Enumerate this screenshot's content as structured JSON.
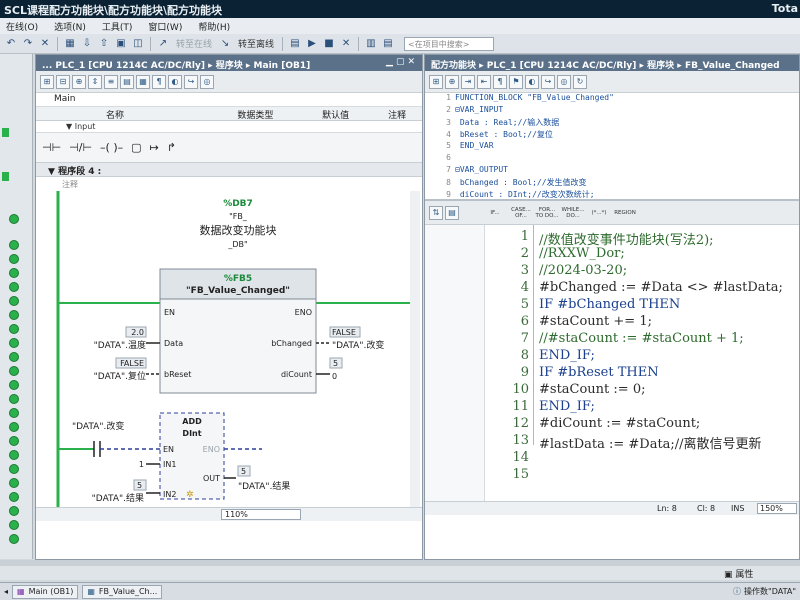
{
  "window": {
    "title": "SCL课程配方功能块\\配方功能块\\配方功能块",
    "title_right": "Tota"
  },
  "menu": [
    "在线(O)",
    "选项(N)",
    "工具(T)",
    "窗口(W)",
    "帮助(H)"
  ],
  "toolbar": {
    "go_online": "转至在线",
    "go_offline": "转至离线",
    "search_placeholder": "<在项目中搜索>"
  },
  "left_editor": {
    "breadcrumb": "... PLC_1 [CPU 1214C AC/DC/Rly] ▸ 程序块 ▸ Main [OB1]",
    "block_name": "Main",
    "iface_cols": [
      "名称",
      "数据类型",
      "默认值",
      "注释"
    ],
    "iface_row": "Input",
    "network": "程序段 4 :",
    "comment": "注释",
    "fb": {
      "instance_db": "%DB7",
      "instance_name": "\"FB_\n数据改变功能块\n_DB\"",
      "fb_num": "%FB5",
      "fb_name": "\"FB_Value_Changed\"",
      "en": "EN",
      "eno": "ENO",
      "pin_data": "Data",
      "pin_breset": "bReset",
      "pin_bchanged": "bChanged",
      "pin_dicount": "diCount",
      "data_val": "2.0",
      "data_var": "\"DATA\".温度",
      "breset_val": "FALSE",
      "breset_var": "\"DATA\".复位",
      "bchanged_val": "FALSE",
      "bchanged_var": "\"DATA\".改变",
      "dicount_val": "5",
      "dicount_tail": "0"
    },
    "add": {
      "title": "ADD",
      "type": "DInt",
      "contact_var": "\"DATA\".改变",
      "en": "EN",
      "eno": "ENO",
      "in1": "IN1",
      "in2": "IN2",
      "out": "OUT",
      "in1_val": "1",
      "in2_val": "5",
      "in2_var": "\"DATA\".结果",
      "out_val": "5",
      "out_var": "\"DATA\".结果"
    },
    "zoom": "110%"
  },
  "right_editor": {
    "breadcrumb": "配方功能块 ▸ PLC_1 [CPU 1214C AC/DC/Rly] ▸ 程序块 ▸ FB_Value_Changed",
    "decl_lines": [
      {
        "n": "1",
        "t": "FUNCTION_BLOCK \"FB_Value_Changed\""
      },
      {
        "n": "2",
        "t": "⊟VAR_INPUT"
      },
      {
        "n": "3",
        "t": "    Data : Real;//输入数据"
      },
      {
        "n": "4",
        "t": "    bReset : Bool;//复位"
      },
      {
        "n": "5",
        "t": "  END_VAR"
      },
      {
        "n": "6",
        "t": ""
      },
      {
        "n": "7",
        "t": "⊟VAR_OUTPUT"
      },
      {
        "n": "8",
        "t": "    bChanged : Bool;//发生值改变"
      },
      {
        "n": "9",
        "t": "    diCount : DInt;//改变次数统计;"
      }
    ],
    "scl_buttons": [
      "IF...",
      "CASE... OF...",
      "FOR... TO DO...",
      "WHILE... DO...",
      "(*...*)",
      "REGION"
    ],
    "code_lines": [
      {
        "n": "1",
        "t": "//数值改变事件功能块(写法2);",
        "k": "c"
      },
      {
        "n": "2",
        "t": "//RXXW_Dor;",
        "k": "c"
      },
      {
        "n": "3",
        "t": "//2024-03-20;",
        "k": "c"
      },
      {
        "n": "4",
        "t": "#bChanged := #Data <> #lastData;",
        "k": "p"
      },
      {
        "n": "5",
        "t": "IF #bChanged THEN",
        "k": "k"
      },
      {
        "n": "6",
        "t": "    #staCount += 1;",
        "k": "p"
      },
      {
        "n": "7",
        "t": "    //#staCount := #staCount + 1;",
        "k": "c"
      },
      {
        "n": "8",
        "t": "END_IF;",
        "k": "k"
      },
      {
        "n": "9",
        "t": "IF #bReset THEN",
        "k": "k"
      },
      {
        "n": "10",
        "t": "    #staCount := 0;",
        "k": "p"
      },
      {
        "n": "11",
        "t": "END_IF;",
        "k": "k"
      },
      {
        "n": "12",
        "t": "#diCount := #staCount;",
        "k": "p"
      },
      {
        "n": "13",
        "t": "#lastData := #Data;//离散信号更新",
        "k": "p"
      },
      {
        "n": "14",
        "t": "",
        "k": "p"
      },
      {
        "n": "15",
        "t": "",
        "k": "p"
      }
    ],
    "status": {
      "ln": "Ln: 8",
      "cl": "Cl: 8",
      "ins": "INS",
      "zoom": "150%"
    }
  },
  "bottom": {
    "properties": "属性",
    "info_text": "操作数\"DATA\""
  },
  "taskbar": {
    "tasks": [
      "Main (OB1)",
      "FB_Value_Ch..."
    ]
  }
}
